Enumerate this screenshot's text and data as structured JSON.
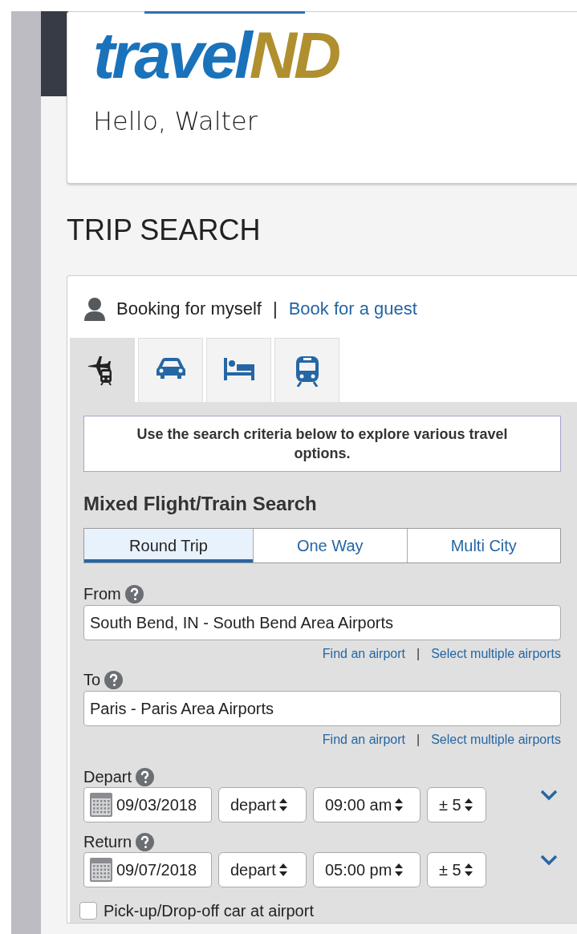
{
  "logo": [
    {
      "text": "travel",
      "color": "#1a72bb"
    },
    {
      "text": "ND",
      "color": "#b08f2e"
    }
  ],
  "greeting": "Hello, Walter",
  "page_title": "TRIP SEARCH",
  "booking": {
    "self_label": "Booking for myself",
    "separator": "|",
    "guest_link": "Book for a guest"
  },
  "tabs": [
    {
      "kind": "flight-train",
      "selected": true
    },
    {
      "kind": "car",
      "selected": false
    },
    {
      "kind": "hotel",
      "selected": false
    },
    {
      "kind": "train",
      "selected": false
    }
  ],
  "notice": "Use the search criteria below to explore various travel options.",
  "search_title": "Mixed Flight/Train Search",
  "trip_types": [
    {
      "label": "Round Trip",
      "selected": true
    },
    {
      "label": "One Way",
      "selected": false
    },
    {
      "label": "Multi City",
      "selected": false
    }
  ],
  "locations": [
    {
      "label": "From",
      "value": "South Bend, IN - South Bend Area Airports",
      "links": [
        "Find an airport",
        "|",
        "Select multiple airports"
      ]
    },
    {
      "label": "To",
      "value": "Paris - Paris Area Airports",
      "links": [
        "Find an airport",
        "|",
        "Select multiple airports"
      ]
    }
  ],
  "dates": [
    {
      "label": "Depart",
      "date": "09/03/2018",
      "mode": "depart",
      "time": "09:00 am",
      "range": "± 5"
    },
    {
      "label": "Return",
      "date": "09/07/2018",
      "mode": "depart",
      "time": "05:00 pm",
      "range": "± 5"
    }
  ],
  "car_option": {
    "label": "Pick-up/Drop-off car at airport",
    "checked": false
  }
}
